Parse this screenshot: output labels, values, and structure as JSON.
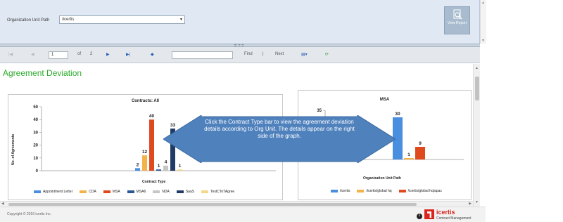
{
  "params": {
    "org_unit_label": "Organization Unit Path",
    "org_unit_value": "/icertis",
    "view_report_label": "View Report"
  },
  "toolbar": {
    "page_current": "1",
    "page_of": "of",
    "page_total": "2",
    "find_label": "Find",
    "separator": "|",
    "next_label": "Next"
  },
  "report": {
    "title": "Agreement Deviation"
  },
  "chart_data": [
    {
      "type": "bar",
      "title": "Contracts: All",
      "xlabel": "Contract Type",
      "ylabel": "No. of Agreements",
      "ylim": [
        0,
        50
      ],
      "yticks": [
        0,
        10,
        20,
        30,
        40,
        50
      ],
      "series": [
        {
          "name": "Appointment Letter",
          "value": 2,
          "color": "#4a8fdf"
        },
        {
          "name": "CDA",
          "value": 12,
          "color": "#f4b24a"
        },
        {
          "name": "MSA",
          "value": 40,
          "color": "#e0491e"
        },
        {
          "name": "MSA6",
          "value": 1,
          "color": "#2a5692"
        },
        {
          "name": "NDA",
          "value": 4,
          "color": "#c6c6c6"
        },
        {
          "name": "SaaS",
          "value": 33,
          "color": "#203c66"
        },
        {
          "name": "TestCToTAgree",
          "value": 1,
          "color": "#f2d888"
        }
      ],
      "legend": "bottom"
    },
    {
      "type": "bar",
      "title": "MSA",
      "xlabel": "Organization Unit Path",
      "ylim": [
        0,
        35
      ],
      "yticks": [
        0,
        35
      ],
      "series": [
        {
          "name": "/icertis",
          "value": 30,
          "color": "#4a8fdf"
        },
        {
          "name": "/icertis/global hq",
          "value": 1,
          "color": "#f4b24a"
        },
        {
          "name": "/icertis/global hq/apac",
          "value": 9,
          "color": "#e0491e"
        }
      ],
      "legend": "bottom"
    }
  ],
  "callout": {
    "text": "Click the Contract Type bar to view the agreement deviation details according to Org Unit. The details appear on the right side of the graph."
  },
  "footer": {
    "copyright": "Copyright © 2016 icertis Inc.",
    "info_glyph": "i",
    "logo_name": "icertis",
    "logo_tagline": "Contract Management"
  }
}
